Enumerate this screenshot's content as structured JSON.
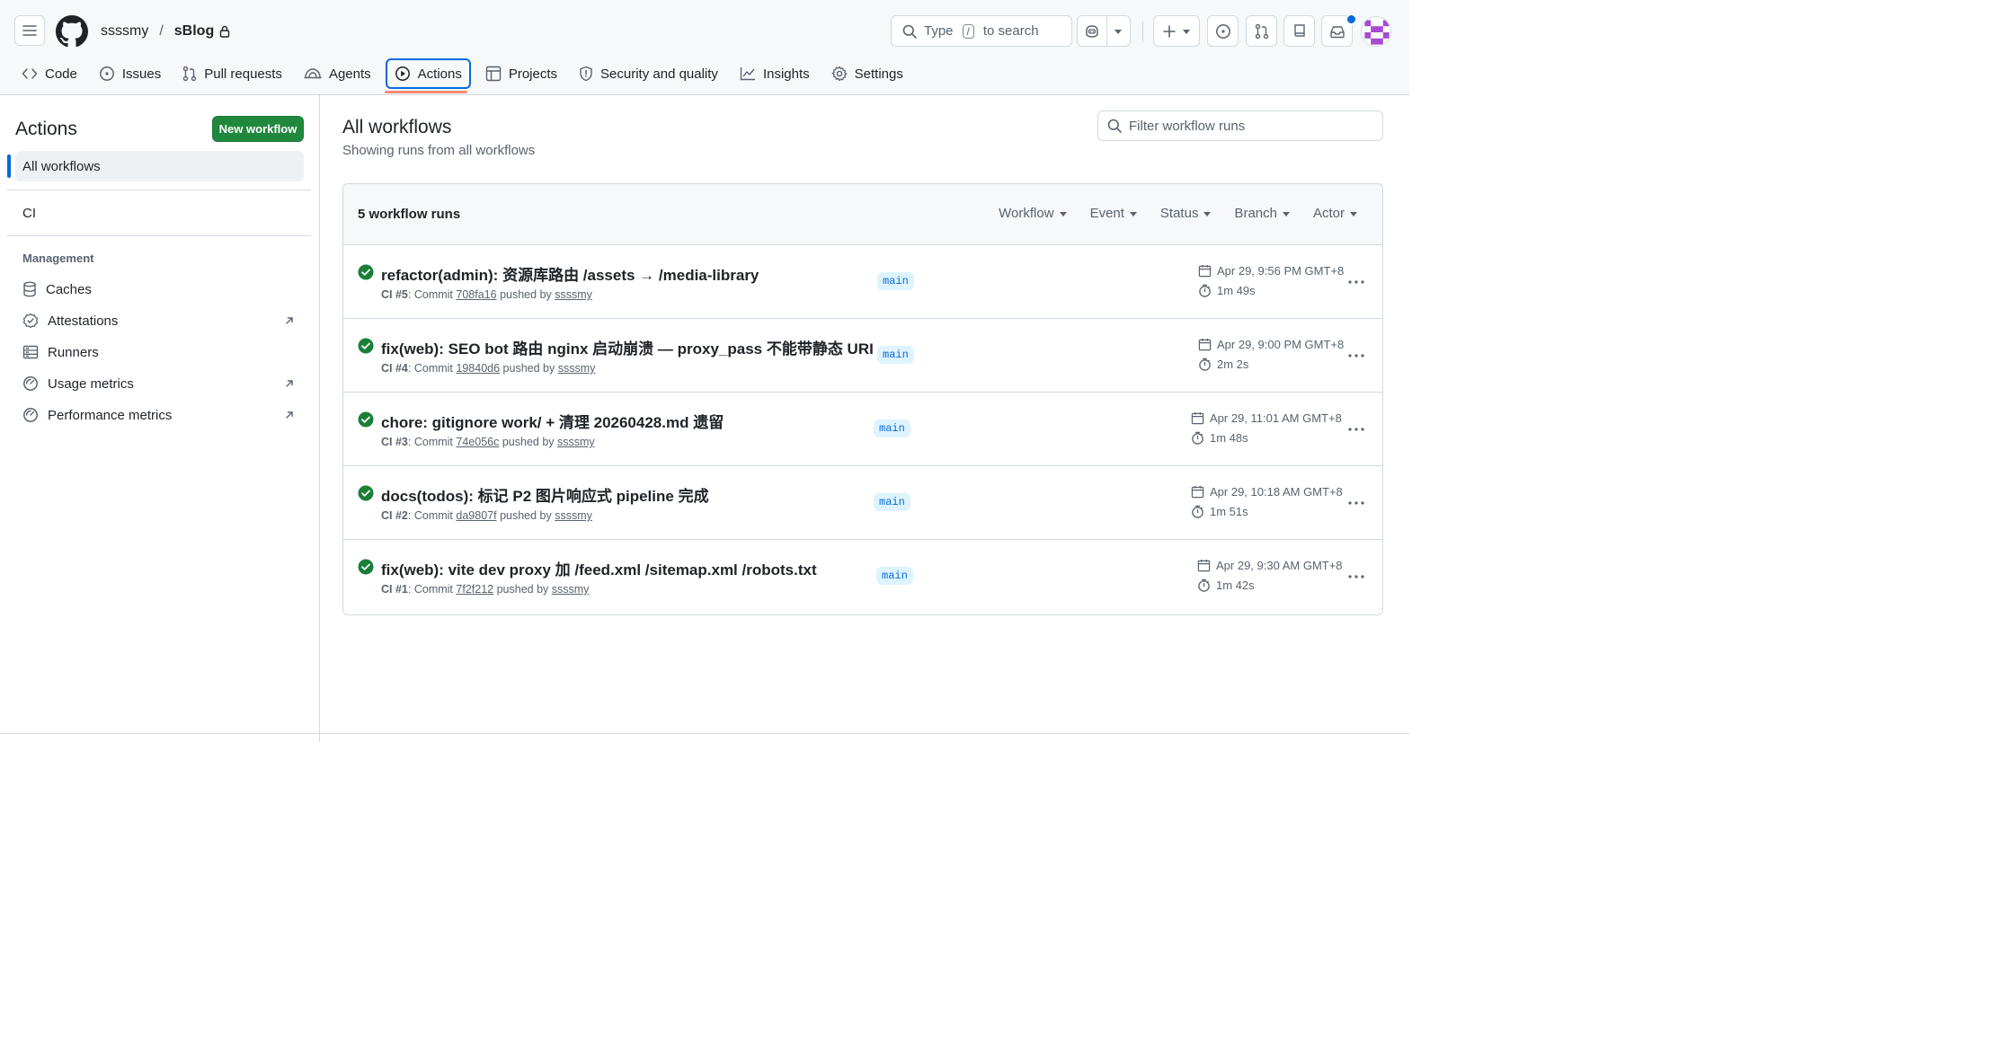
{
  "repo": {
    "owner": "ssssmy",
    "separator": "/",
    "name": "sBlog"
  },
  "search": {
    "prefix": "Type",
    "key": "/",
    "suffix": "to search"
  },
  "tabs": [
    {
      "label": "Code",
      "icon": "code-icon"
    },
    {
      "label": "Issues",
      "icon": "issue-icon"
    },
    {
      "label": "Pull requests",
      "icon": "pull-request-icon"
    },
    {
      "label": "Agents",
      "icon": "agents-icon"
    },
    {
      "label": "Actions",
      "icon": "play-icon",
      "active": true
    },
    {
      "label": "Projects",
      "icon": "table-icon"
    },
    {
      "label": "Security and quality",
      "icon": "shield-icon"
    },
    {
      "label": "Insights",
      "icon": "graph-icon"
    },
    {
      "label": "Settings",
      "icon": "gear-icon"
    }
  ],
  "sidebar": {
    "title": "Actions",
    "new_workflow": "New workflow",
    "all_workflows": "All workflows",
    "workflows": [
      "CI"
    ],
    "management_title": "Management",
    "management": [
      {
        "label": "Caches",
        "icon": "database-icon",
        "external": false
      },
      {
        "label": "Attestations",
        "icon": "verified-icon",
        "external": true
      },
      {
        "label": "Runners",
        "icon": "server-icon",
        "external": false
      },
      {
        "label": "Usage metrics",
        "icon": "meter-icon",
        "external": true
      },
      {
        "label": "Performance metrics",
        "icon": "meter-icon",
        "external": true
      }
    ]
  },
  "main": {
    "title": "All workflows",
    "subtitle": "Showing runs from all workflows",
    "filter_placeholder": "Filter workflow runs",
    "runs_count": "5 workflow runs",
    "filters": [
      "Workflow",
      "Event",
      "Status",
      "Branch",
      "Actor"
    ]
  },
  "runs": [
    {
      "title": "refactor(admin): 资源库路由 /assets → /media-library",
      "workflow": "CI",
      "number": "#5",
      "commit_label": "Commit",
      "commit": "708fa16",
      "pushed_by": "pushed by",
      "user": "ssssmy",
      "branch": "main",
      "date": "Apr 29, 9:56 PM GMT+8",
      "duration": "1m 49s",
      "status": "success"
    },
    {
      "title": "fix(web): SEO bot 路由 nginx 启动崩溃 — proxy_pass 不能带静态 URI",
      "workflow": "CI",
      "number": "#4",
      "commit_label": "Commit",
      "commit": "19840d6",
      "pushed_by": "pushed by",
      "user": "ssssmy",
      "branch": "main",
      "date": "Apr 29, 9:00 PM GMT+8",
      "duration": "2m 2s",
      "status": "success"
    },
    {
      "title": "chore: gitignore work/ + 清理 20260428.md 遗留",
      "workflow": "CI",
      "number": "#3",
      "commit_label": "Commit",
      "commit": "74e056c",
      "pushed_by": "pushed by",
      "user": "ssssmy",
      "branch": "main",
      "date": "Apr 29, 11:01 AM GMT+8",
      "duration": "1m 48s",
      "status": "success"
    },
    {
      "title": "docs(todos): 标记 P2 图片响应式 pipeline 完成",
      "workflow": "CI",
      "number": "#2",
      "commit_label": "Commit",
      "commit": "da9807f",
      "pushed_by": "pushed by",
      "user": "ssssmy",
      "branch": "main",
      "date": "Apr 29, 10:18 AM GMT+8",
      "duration": "1m 51s",
      "status": "success"
    },
    {
      "title": "fix(web): vite dev proxy 加 /feed.xml /sitemap.xml /robots.txt",
      "workflow": "CI",
      "number": "#1",
      "commit_label": "Commit",
      "commit": "7f2f212",
      "pushed_by": "pushed by",
      "user": "ssssmy",
      "branch": "main",
      "date": "Apr 29, 9:30 AM GMT+8",
      "duration": "1m 42s",
      "status": "success"
    }
  ],
  "colors": {
    "accent": "#0969da",
    "success": "#1a7f37",
    "primary_button": "#1f883d",
    "tab_underline": "#fd8c73"
  }
}
